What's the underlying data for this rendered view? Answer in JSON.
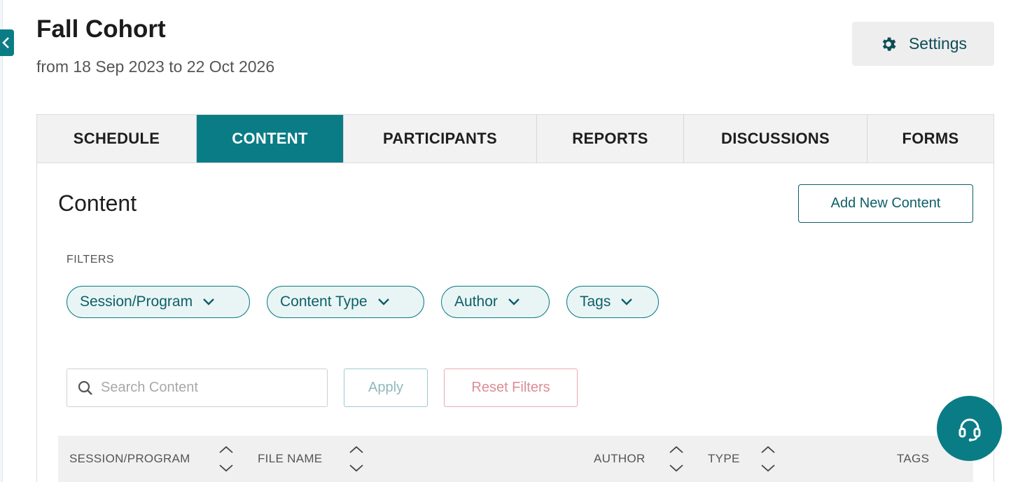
{
  "header": {
    "title": "Fall Cohort",
    "subtitle": "from 18 Sep 2023 to 22 Oct 2026",
    "settings_label": "Settings"
  },
  "tabs": [
    {
      "label": "SCHEDULE",
      "active": false
    },
    {
      "label": "CONTENT",
      "active": true
    },
    {
      "label": "PARTICIPANTS",
      "active": false
    },
    {
      "label": "REPORTS",
      "active": false
    },
    {
      "label": "DISCUSSIONS",
      "active": false
    },
    {
      "label": "FORMS",
      "active": false
    }
  ],
  "content": {
    "title": "Content",
    "add_button_label": "Add New Content",
    "filters_label": "FILTERS",
    "filters": [
      {
        "label": "Session/Program"
      },
      {
        "label": "Content Type"
      },
      {
        "label": "Author"
      },
      {
        "label": "Tags"
      }
    ],
    "search": {
      "placeholder": "Search Content",
      "value": ""
    },
    "apply_label": "Apply",
    "reset_label": "Reset Filters"
  },
  "table": {
    "columns": [
      {
        "label": "SESSION/PROGRAM",
        "sortable": true
      },
      {
        "label": "FILE NAME",
        "sortable": true
      },
      {
        "label": "AUTHOR",
        "sortable": true
      },
      {
        "label": "TYPE",
        "sortable": true
      },
      {
        "label": "TAGS",
        "sortable": false
      }
    ]
  },
  "colors": {
    "accent": "#0a7c86",
    "accent_dark": "#0d5f68",
    "reset": "#dc8d97"
  },
  "icons": {
    "collapse": "chevron-left-icon",
    "settings": "gear-icon",
    "filter_chevron": "chevron-down-icon",
    "search": "search-icon",
    "sort": "sort-arrows-icon",
    "help": "headset-icon"
  }
}
